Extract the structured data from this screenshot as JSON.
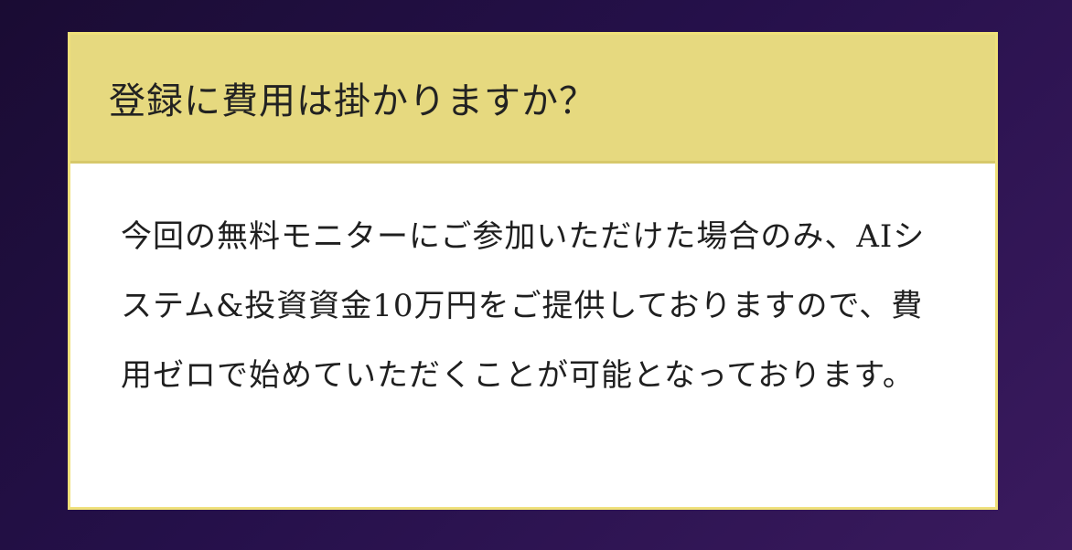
{
  "faq": {
    "question": "登録に費用は掛かりますか？",
    "answer": "今回の無料モニターにご参加いただけた場合のみ、AIシステム&投資資金10万円をご提供しておりますので、費用ゼロで始めていただくことが可能となっております。"
  },
  "colors": {
    "header_bg": "#e6d97f",
    "border": "#efe07a",
    "card_bg": "#ffffff",
    "page_bg_dark": "#1a0c33",
    "page_bg_light": "#3a1a5e"
  }
}
